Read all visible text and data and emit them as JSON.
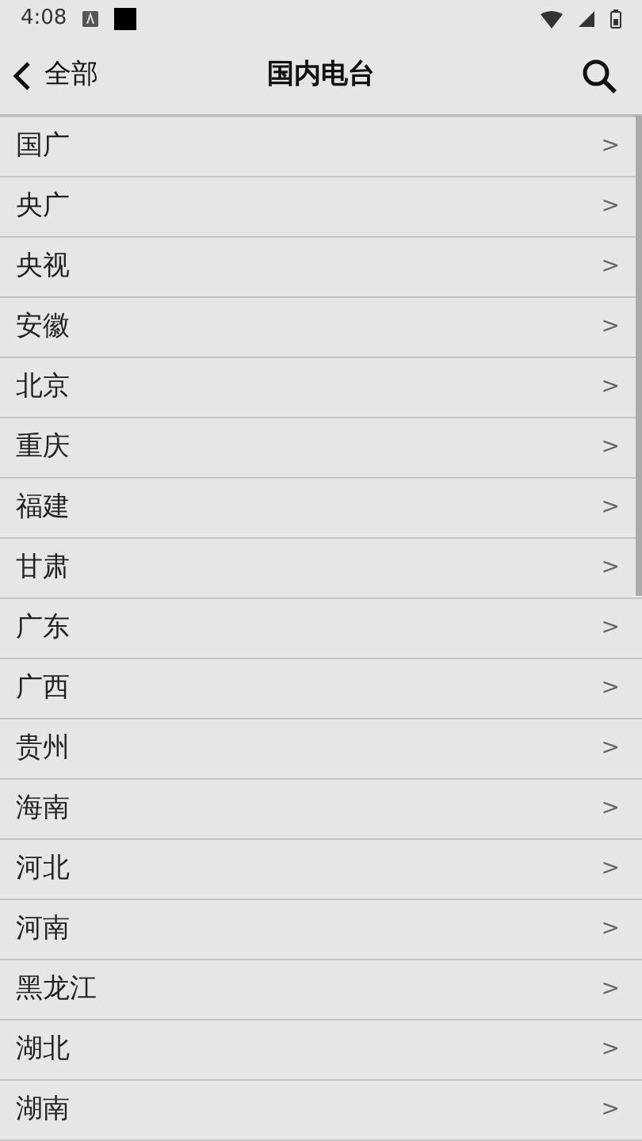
{
  "status_bar": {
    "time": "4:08"
  },
  "header": {
    "back_label": "全部",
    "title": "国内电台"
  },
  "items": [
    {
      "label": "国广",
      "arrow": ">"
    },
    {
      "label": "央广",
      "arrow": ">"
    },
    {
      "label": "央视",
      "arrow": ">"
    },
    {
      "label": "安徽",
      "arrow": ">"
    },
    {
      "label": "北京",
      "arrow": ">"
    },
    {
      "label": "重庆",
      "arrow": ">"
    },
    {
      "label": "福建",
      "arrow": ">"
    },
    {
      "label": "甘肃",
      "arrow": ">"
    },
    {
      "label": "广东",
      "arrow": ">"
    },
    {
      "label": "广西",
      "arrow": ">"
    },
    {
      "label": "贵州",
      "arrow": ">"
    },
    {
      "label": "海南",
      "arrow": ">"
    },
    {
      "label": "河北",
      "arrow": ">"
    },
    {
      "label": "河南",
      "arrow": ">"
    },
    {
      "label": "黑龙江",
      "arrow": ">"
    },
    {
      "label": "湖北",
      "arrow": ">"
    },
    {
      "label": "湖南",
      "arrow": ">"
    }
  ]
}
